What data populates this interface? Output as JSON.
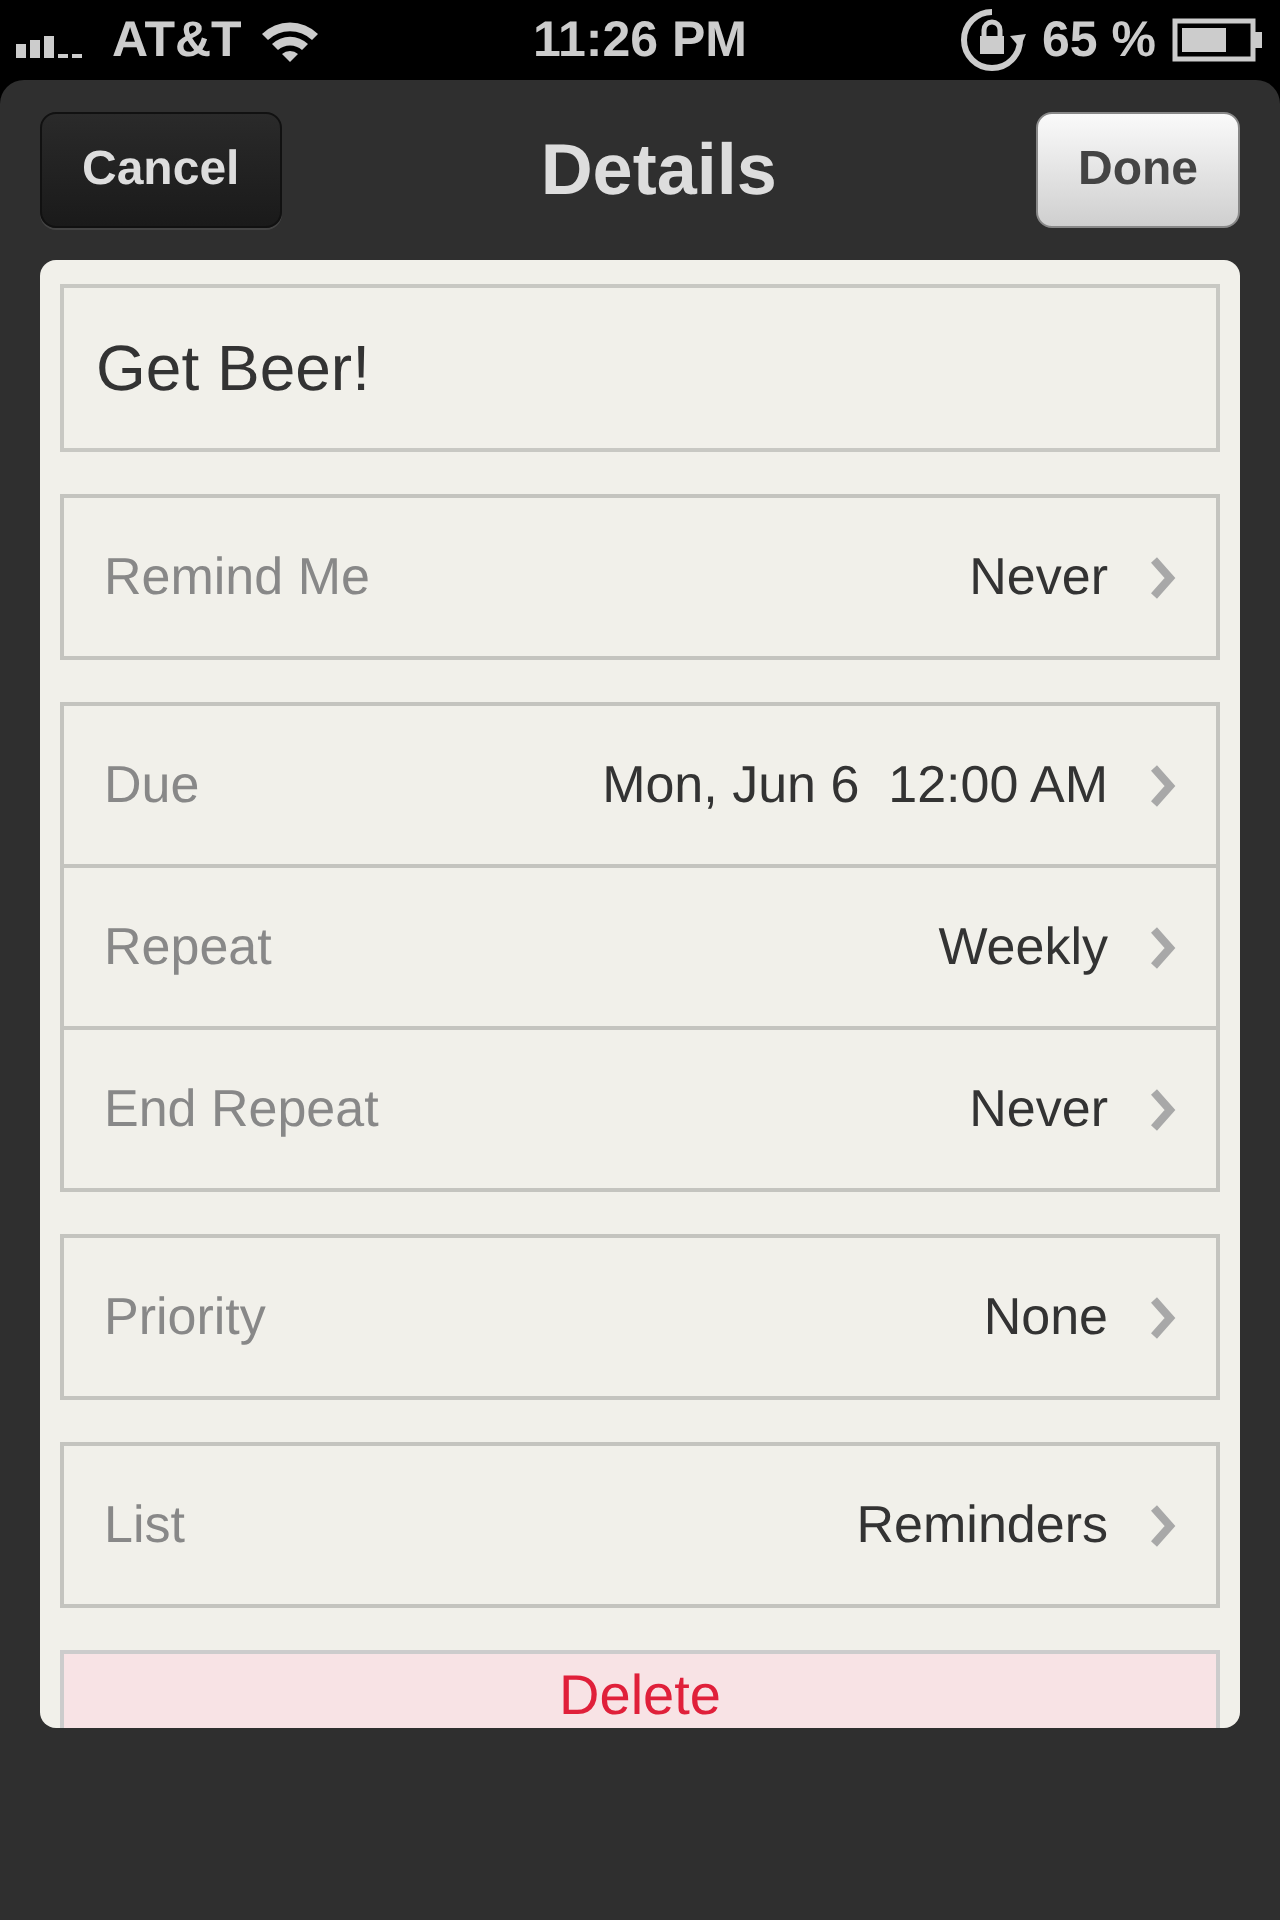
{
  "status_bar": {
    "carrier": "AT&T",
    "time": "11:26 PM",
    "battery": "65 %"
  },
  "nav": {
    "cancel": "Cancel",
    "title": "Details",
    "done": "Done"
  },
  "title_field": {
    "value": "Get Beer!"
  },
  "groups": [
    [
      {
        "label": "Remind Me",
        "value": "Never"
      }
    ],
    [
      {
        "label": "Due",
        "value": "Mon, Jun 6  12:00 AM"
      },
      {
        "label": "Repeat",
        "value": "Weekly"
      },
      {
        "label": "End Repeat",
        "value": "Never"
      }
    ],
    [
      {
        "label": "Priority",
        "value": "None"
      }
    ],
    [
      {
        "label": "List",
        "value": "Reminders"
      }
    ]
  ],
  "delete_button": "Delete"
}
